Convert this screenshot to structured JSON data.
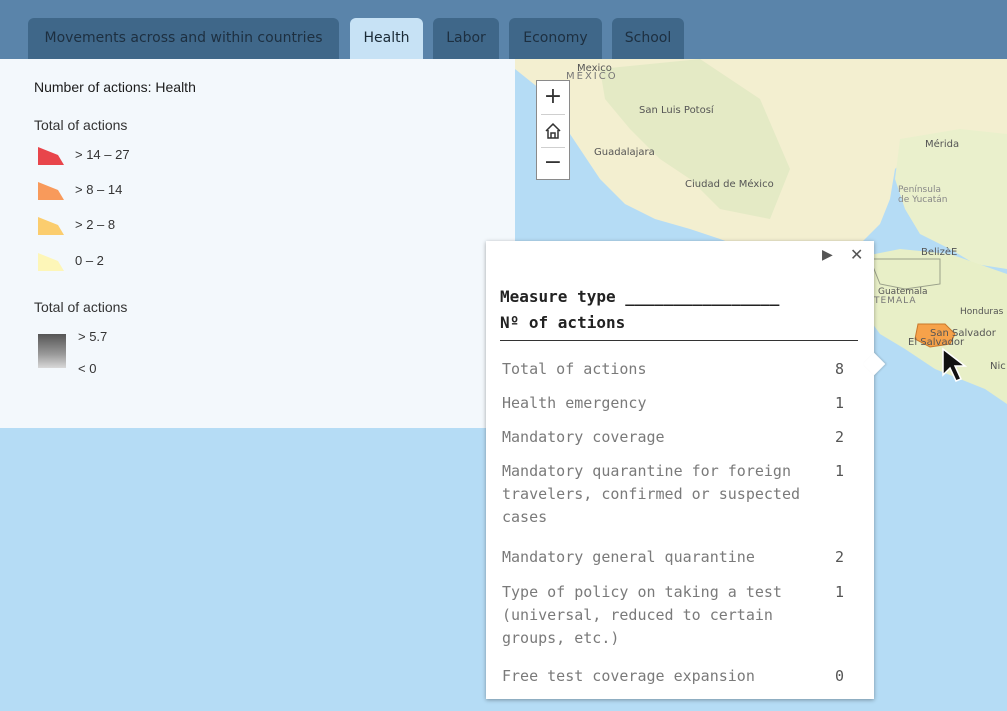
{
  "tabs": [
    {
      "label": "Movements across and within countries",
      "active": false
    },
    {
      "label": "Health",
      "active": true
    },
    {
      "label": "Labor",
      "active": false
    },
    {
      "label": "Economy",
      "active": false
    },
    {
      "label": "School",
      "active": false
    }
  ],
  "legend": {
    "title": "Number of actions: Health",
    "section1_title": "Total of actions",
    "classes": [
      {
        "label": "> 14 – 27",
        "color": "#e8454b"
      },
      {
        "label": "> 8 – 14",
        "color": "#f89a5b"
      },
      {
        "label": "> 2 – 8",
        "color": "#fbcd6e"
      },
      {
        "label": "0 – 2",
        "color": "#fdf6b8"
      }
    ],
    "section2_title": "Total of actions",
    "gradient": {
      "high": "> 5.7",
      "low": "< 0"
    }
  },
  "map": {
    "labels": {
      "mexico": "Mexico",
      "mexico_es": "MÉXICO",
      "san_luis": "San Luis Potosí",
      "guadalajara": "Guadalajara",
      "cdmx": "Ciudad de México",
      "merida": "Mérida",
      "yucatan1": "Península",
      "yucatan2": "de Yucatán",
      "belize": "BelizèE",
      "guatemala": "Guatemala",
      "guatemala_es": "TEMALA",
      "honduras": "Honduras",
      "san_salvador": "San Salvador",
      "el_salvador": "El Salvador",
      "nicaragua": "Nic"
    },
    "colors": {
      "water": "#b5dcf5",
      "land": "#f3efd0",
      "highlight": "#f6a24a"
    }
  },
  "zoom": {
    "in_icon": "plus-icon",
    "home_icon": "home-icon",
    "out_icon": "minus-icon"
  },
  "popup": {
    "header_line1": "Measure type ________________",
    "header_line2": "Nº of actions",
    "rows": [
      {
        "name": "Total of actions",
        "value": "8"
      },
      {
        "name": "Health emergency",
        "value": "1"
      },
      {
        "name": "Mandatory coverage",
        "value": "2"
      },
      {
        "name": "Mandatory quarantine for foreign travelers, confirmed or suspected cases",
        "value": "1"
      },
      {
        "name": "Mandatory general quarantine",
        "value": "2"
      },
      {
        "name": "Type of policy on taking a test (universal, reduced to certain groups, etc.)",
        "value": "1"
      },
      {
        "name": "Free test coverage expansion",
        "value": "0"
      }
    ]
  }
}
